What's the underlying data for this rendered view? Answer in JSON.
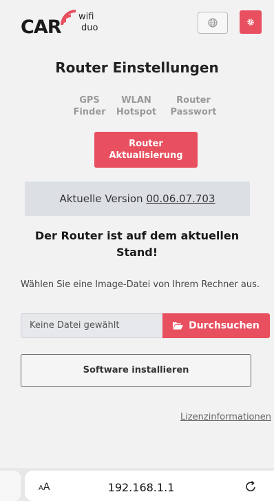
{
  "header": {
    "logo": {
      "car": "CAR",
      "wifi": "wifi",
      "duo": "duo"
    },
    "lang_icon": "globe-icon",
    "settings_icon": "gear-icon",
    "accent_color": "#e8505f"
  },
  "page": {
    "title_bold": "Router",
    "title_rest": "Einstellungen"
  },
  "nav": [
    {
      "line1": "GPS",
      "line2": "Finder"
    },
    {
      "line1": "WLAN",
      "line2": "Hotspot"
    },
    {
      "line1": "Router",
      "line2": "Passwort"
    }
  ],
  "update_button": {
    "line1": "Router",
    "line2": "Aktualisierung"
  },
  "version": {
    "label": "Aktuelle Version",
    "value": "00.06.07.703"
  },
  "status": {
    "line1": "Der Router ist auf dem aktuellen",
    "line2": "Stand!"
  },
  "upload": {
    "hint": "Wählen Sie eine Image-Datei von Ihrem Rechner aus.",
    "placeholder": "Keine Datei gewählt",
    "browse_label": "Durchsuchen",
    "browse_icon": "folder-open-icon"
  },
  "install_button": "Software installieren",
  "license_link": "Lizenzinformationen",
  "browser": {
    "text_size_a_small": "A",
    "text_size_a_large": "A",
    "url": "192.168.1.1",
    "reload_icon": "reload-icon"
  }
}
